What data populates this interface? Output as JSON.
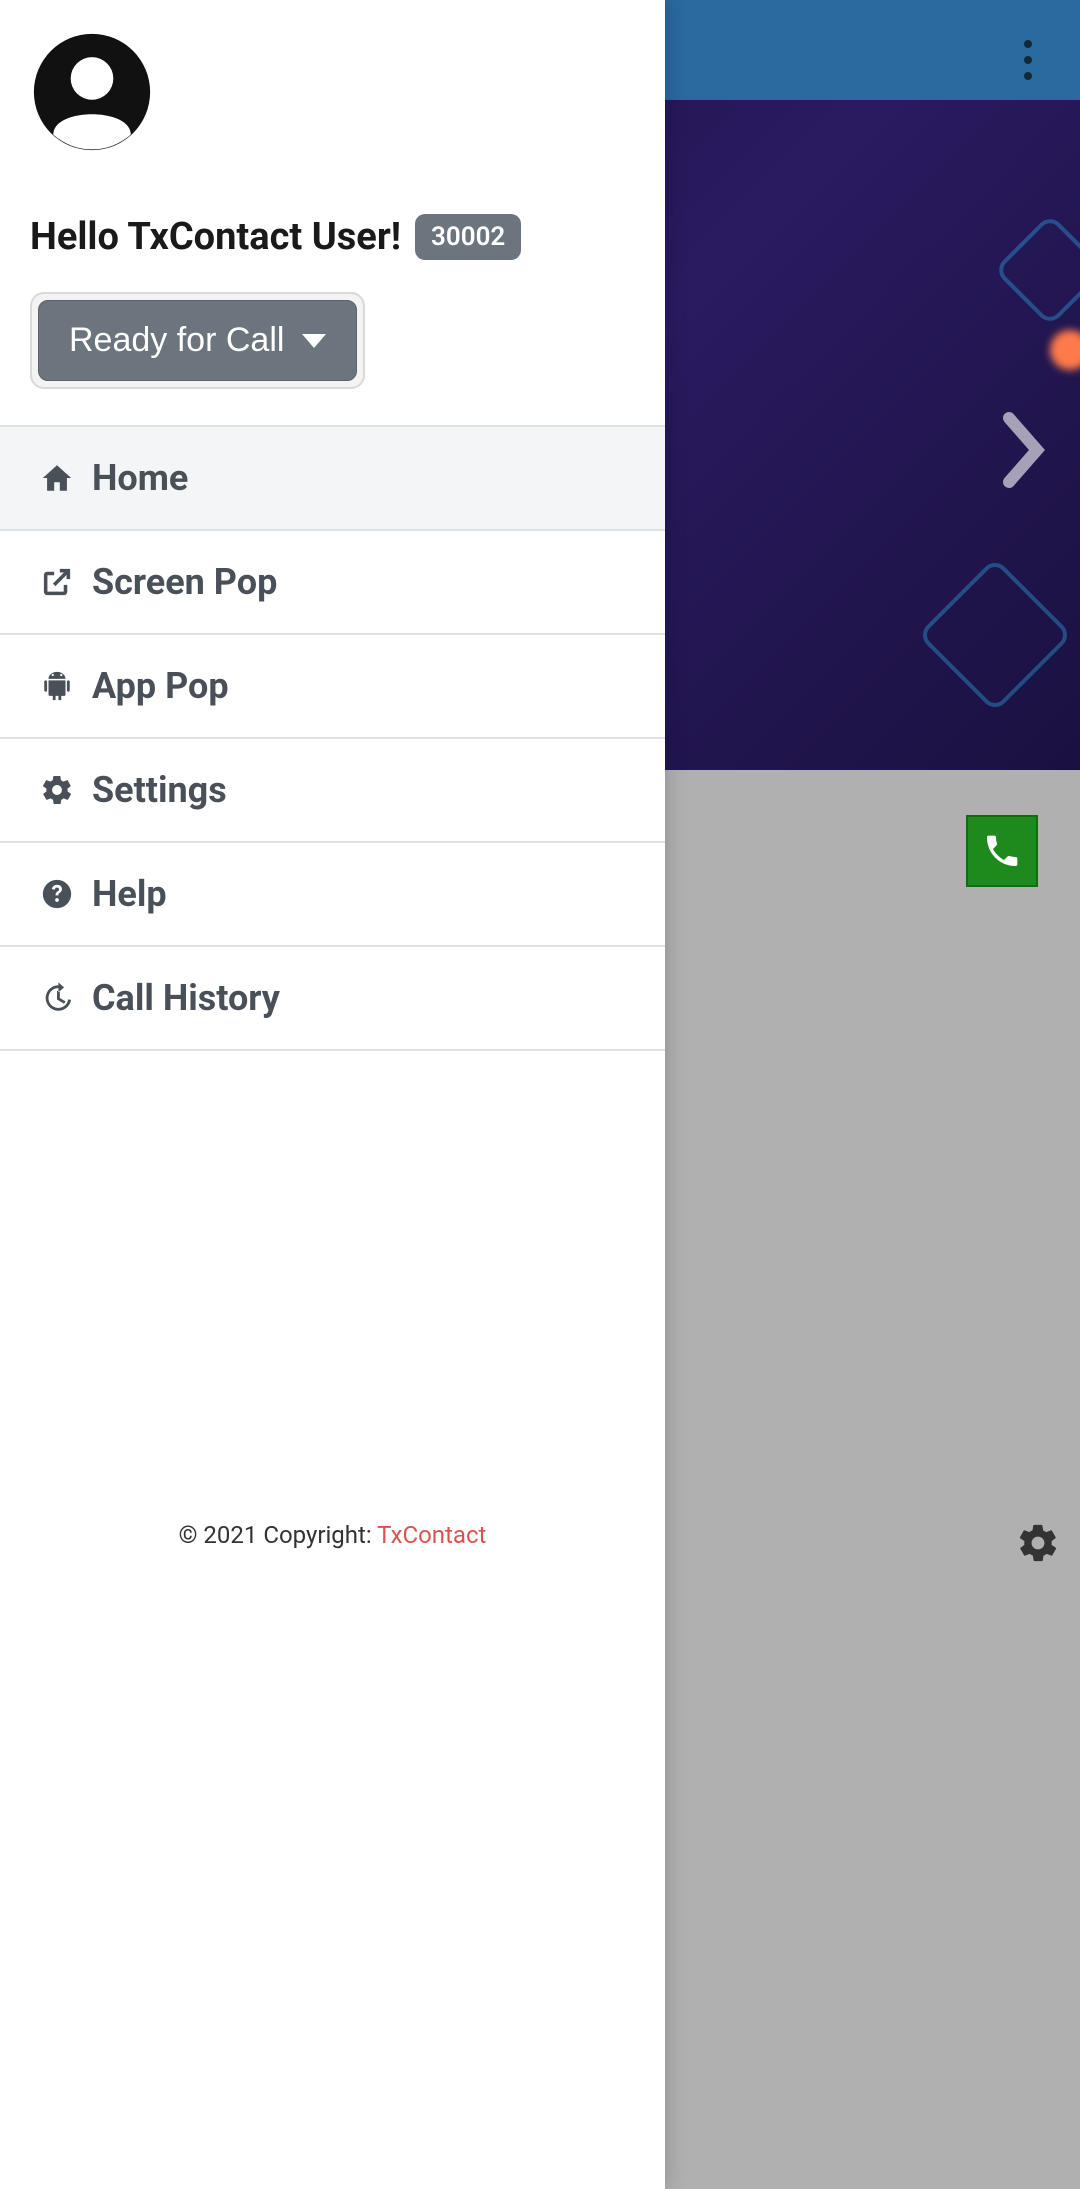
{
  "header": {
    "greeting": "Hello TxContact User!",
    "user_id_badge": "30002",
    "status_button_label": "Ready for Call"
  },
  "menu": {
    "items": [
      {
        "label": "Home",
        "icon": "home-icon",
        "active": true
      },
      {
        "label": "Screen Pop",
        "icon": "external-link-icon",
        "active": false
      },
      {
        "label": "App Pop",
        "icon": "android-icon",
        "active": false
      },
      {
        "label": "Settings",
        "icon": "gear-icon",
        "active": false
      },
      {
        "label": "Help",
        "icon": "question-circle-icon",
        "active": false
      },
      {
        "label": "Call History",
        "icon": "history-icon",
        "active": false
      }
    ]
  },
  "footer": {
    "copyright_prefix": "© 2021 Copyright: ",
    "brand": "TxContact"
  },
  "background": {
    "call_button_icon": "phone-icon",
    "settings_icon": "gear-icon"
  }
}
